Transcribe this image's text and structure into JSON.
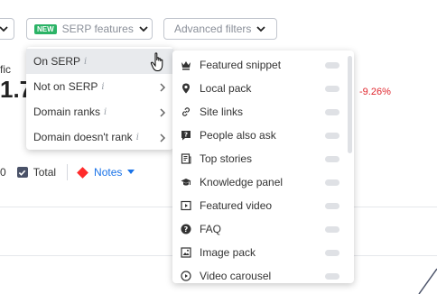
{
  "toolbar": {
    "serp_features": {
      "badge": "NEW",
      "label": "SERP features"
    },
    "advanced_filters": {
      "label": "Advanced filters"
    }
  },
  "background": {
    "traffic_label": "fic",
    "traffic_value": "1.7",
    "change_percent": "-9.26%",
    "legend_prefix": "0",
    "legend_total": "Total",
    "legend_notes": "Notes"
  },
  "menu": {
    "items": [
      {
        "label": "On SERP",
        "info": "i",
        "active": true
      },
      {
        "label": "Not on SERP",
        "info": "i",
        "active": false
      },
      {
        "label": "Domain ranks",
        "info": "i",
        "active": false
      },
      {
        "label": "Domain doesn't rank",
        "info": "i",
        "active": false
      }
    ]
  },
  "submenu": {
    "items": [
      {
        "label": "Featured snippet",
        "icon": "crown-icon"
      },
      {
        "label": "Local pack",
        "icon": "map-pin-icon"
      },
      {
        "label": "Site links",
        "icon": "link-icon"
      },
      {
        "label": "People also ask",
        "icon": "question-bubble-icon"
      },
      {
        "label": "Top stories",
        "icon": "newspaper-icon"
      },
      {
        "label": "Knowledge panel",
        "icon": "graduation-cap-icon"
      },
      {
        "label": "Featured video",
        "icon": "play-icon"
      },
      {
        "label": "FAQ",
        "icon": "question-circle-icon"
      },
      {
        "label": "Image pack",
        "icon": "image-icon"
      },
      {
        "label": "Video carousel",
        "icon": "play-circle-icon"
      }
    ]
  },
  "colors": {
    "badge_green": "#2bb366",
    "negative_red": "#e0272e",
    "notes_blue": "#1a73e8",
    "notes_diamond": "#ff2b2b"
  }
}
